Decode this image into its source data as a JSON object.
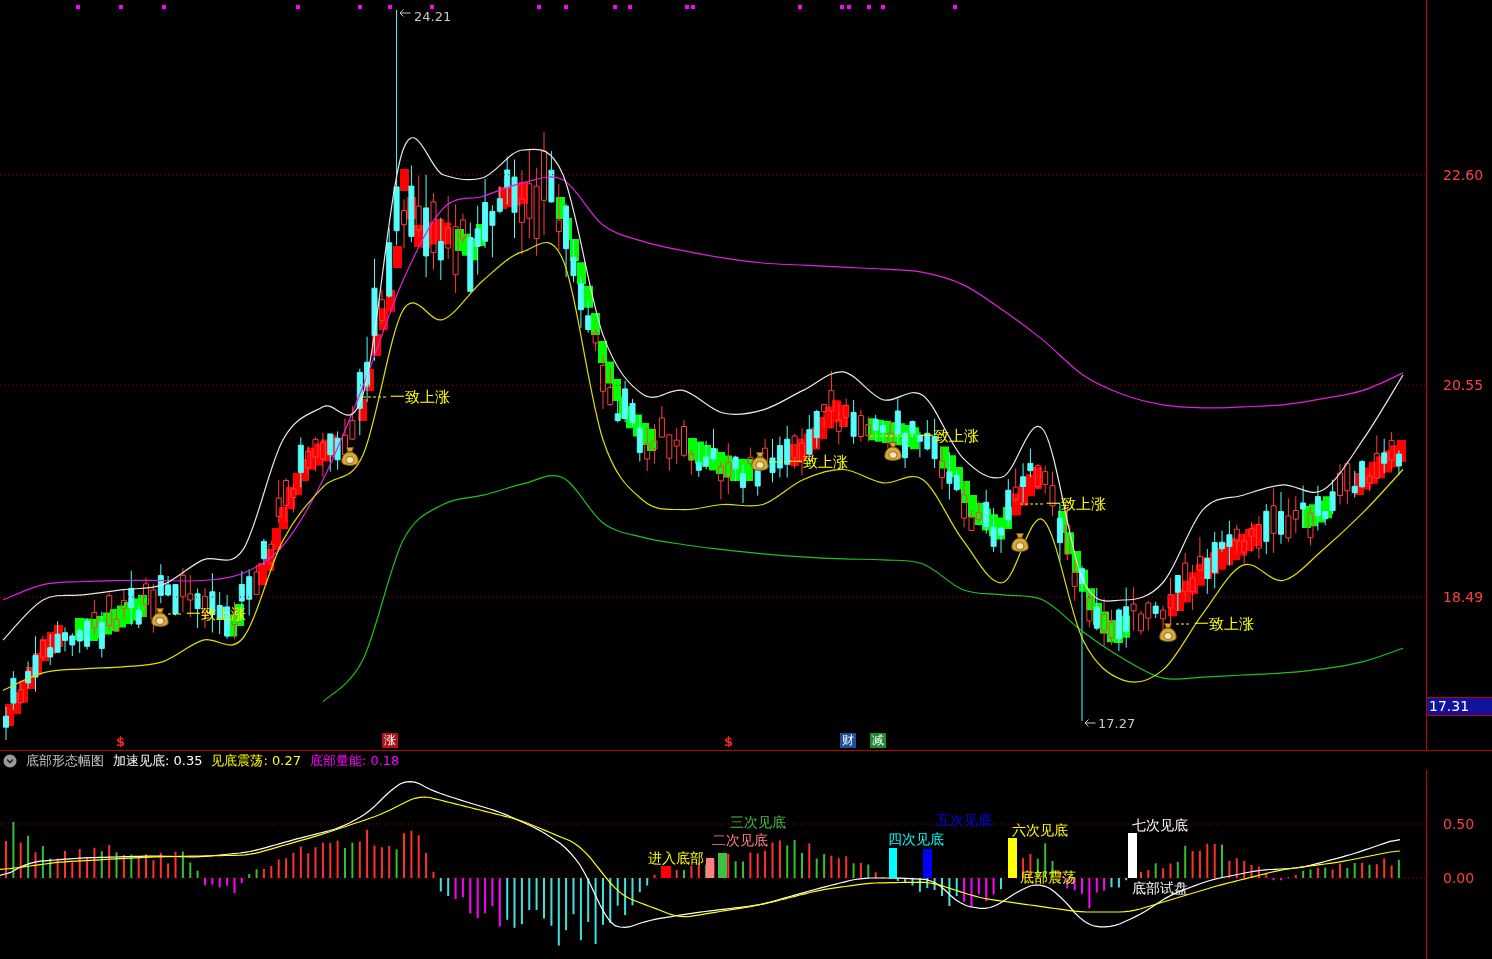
{
  "price_chart": {
    "high_label": "24.21",
    "low_label": "17.27",
    "chart_data": {
      "type": "line",
      "grid": true,
      "ylim": [
        17.0,
        24.3
      ],
      "yticks": [
        {
          "value": 22.6,
          "label": "22.60"
        },
        {
          "value": 20.55,
          "label": "20.55"
        },
        {
          "value": 18.49,
          "label": "18.49"
        }
      ],
      "series": [
        {
          "color": "#e020e0",
          "values": [
            18.46,
            18.61,
            18.64,
            18.65,
            18.65,
            18.65,
            18.72,
            18.99,
            19.63,
            20.54,
            21.57,
            22.27,
            22.39,
            22.52,
            22.55,
            22.11,
            21.95,
            21.86,
            21.79,
            21.74,
            21.72,
            21.7,
            21.68,
            21.65,
            21.53,
            21.28,
            20.99,
            20.65,
            20.46,
            20.36,
            20.33,
            20.34,
            20.36,
            20.42,
            20.5,
            20.67
          ]
        },
        {
          "color": "#20c020",
          "values": [
            null,
            null,
            null,
            null,
            null,
            null,
            null,
            null,
            17.47,
            17.88,
            19.04,
            19.39,
            19.48,
            19.59,
            19.65,
            19.21,
            19.07,
            19.0,
            18.95,
            18.91,
            18.88,
            18.86,
            18.85,
            18.81,
            18.56,
            18.51,
            18.46,
            18.15,
            17.89,
            17.7,
            17.71,
            17.73,
            17.75,
            17.79,
            17.86,
            17.99
          ]
        },
        {
          "color": "#e8e8e8",
          "values": [
            18.07,
            18.46,
            18.51,
            18.56,
            18.61,
            18.85,
            18.95,
            20.02,
            20.34,
            20.46,
            22.84,
            22.6,
            22.57,
            22.84,
            22.6,
            21.04,
            20.46,
            20.5,
            20.28,
            20.31,
            20.5,
            20.68,
            20.41,
            20.45,
            19.84,
            19.66,
            20.12,
            18.65,
            18.46,
            18.63,
            19.34,
            19.48,
            19.58,
            19.53,
            20.02,
            20.65
          ]
        },
        {
          "color": "#e0e000",
          "values": [
            17.58,
            17.75,
            17.79,
            17.81,
            17.86,
            18.07,
            18.09,
            19.04,
            19.56,
            19.87,
            21.28,
            21.19,
            21.57,
            21.85,
            21.77,
            20.02,
            19.43,
            19.34,
            19.39,
            19.39,
            19.63,
            19.73,
            19.6,
            19.63,
            19.04,
            18.63,
            19.24,
            18.07,
            17.68,
            17.78,
            18.33,
            18.8,
            18.65,
            18.95,
            19.31,
            19.73
          ]
        }
      ]
    },
    "signals": [
      {
        "text": "一致上涨"
      },
      {
        "text": "一致上涨"
      },
      {
        "text": "一致上涨"
      },
      {
        "text": "一致上涨"
      },
      {
        "text": "一致上涨"
      },
      {
        "text": "一致上涨"
      }
    ],
    "bottom_markers": [
      {
        "kind": "symbol",
        "text": "$"
      },
      {
        "kind": "tag",
        "text": "涨",
        "color": "#b01414"
      },
      {
        "kind": "symbol",
        "text": "$"
      },
      {
        "kind": "tag",
        "text": "财",
        "color": "#1c4f9c"
      },
      {
        "kind": "tag",
        "text": "减",
        "color": "#1f8a2f"
      }
    ],
    "current_price": "17.31"
  },
  "indicator": {
    "title": "底部形态幅图",
    "legend": [
      {
        "text": "加速见底: 0.35",
        "color": "#ffffff"
      },
      {
        "text": "见底震荡: 0.27",
        "color": "#ffff00"
      },
      {
        "text": "底部量能: 0.18",
        "color": "#ff00ff"
      }
    ],
    "signal_bars": [
      {
        "color": "#ff0000"
      },
      {
        "color": "#ff8080"
      },
      {
        "color": "#40c040"
      },
      {
        "color": "#00ffff"
      },
      {
        "color": "#0000ff"
      },
      {
        "color": "#ffff00"
      },
      {
        "color": "#ffffff"
      }
    ],
    "signals": [
      {
        "text": "进入底部",
        "color": "#ffff00"
      },
      {
        "text": "二次见底",
        "color": "#ff8080"
      },
      {
        "text": "三次见底",
        "color": "#40c040"
      },
      {
        "text": "四次见底",
        "color": "#00ffff"
      },
      {
        "text": "五次见底",
        "color": "#0000ff"
      },
      {
        "text": "六次见底",
        "color": "#ffff00"
      },
      {
        "text": "七次见底",
        "color": "#ffffff"
      }
    ],
    "notes": [
      {
        "text": "底部震荡",
        "color": "#ffff00"
      },
      {
        "text": "底部试盘",
        "color": "#ffffff"
      }
    ],
    "axis_labels": [
      "0.50",
      "0.00"
    ]
  }
}
